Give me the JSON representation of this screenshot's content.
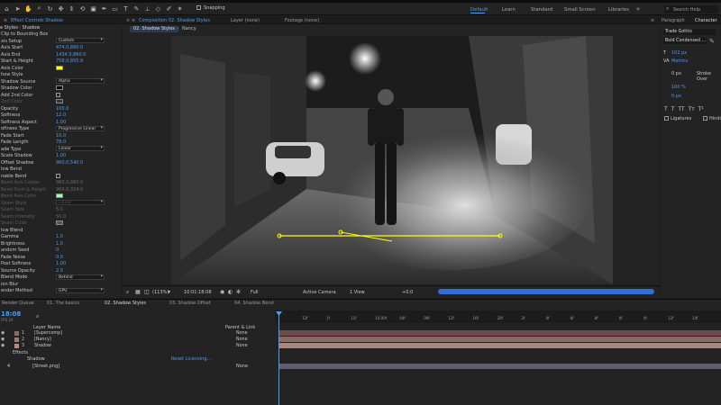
{
  "toolbar": {
    "snapping_label": "Snapping",
    "workspaces": [
      "Default",
      "Learn",
      "Standard",
      "Small Screen",
      "Libraries"
    ],
    "active_workspace": "Default",
    "search_placeholder": "Search Help"
  },
  "effects_panel": {
    "tab_label": "Effect Controls Shadow",
    "header": "e Styles · Shadow",
    "rows": [
      {
        "label": "Clip to Bounding Box",
        "kind": "text",
        "value": "",
        "dim": false
      },
      {
        "label": "xis Setup",
        "kind": "select",
        "value": "Custom"
      },
      {
        "label": "Axis Start",
        "kind": "value",
        "value": "474.0,860.0"
      },
      {
        "label": "Axis End",
        "kind": "value",
        "value": "1434.0,860.0"
      },
      {
        "label": "Start & Height",
        "kind": "value",
        "value": "758.0,855.9"
      },
      {
        "label": "Axis Color",
        "kind": "swatch",
        "value": "#ffff00"
      },
      {
        "label": "how Style",
        "kind": "text",
        "value": ""
      },
      {
        "label": "Shadow Source",
        "kind": "select",
        "value": "Alpha"
      },
      {
        "label": "Shadow Color",
        "kind": "swatch",
        "value": "#000000"
      },
      {
        "label": "Add 2nd Color",
        "kind": "check",
        "value": ""
      },
      {
        "label": "2nd Color",
        "kind": "swatch",
        "value": "#333333",
        "dim": true
      },
      {
        "label": "Opacity",
        "kind": "value",
        "value": "100.0"
      },
      {
        "label": "Softness",
        "kind": "value",
        "value": "12.0"
      },
      {
        "label": "Softness Aspect",
        "kind": "value",
        "value": "1.00"
      },
      {
        "label": "oftness Type",
        "kind": "select",
        "value": "Progressive Linear"
      },
      {
        "label": "Fade Start",
        "kind": "value",
        "value": "10.0"
      },
      {
        "label": "Fade Length",
        "kind": "value",
        "value": "78.0"
      },
      {
        "label": "ade Type",
        "kind": "select",
        "value": "Linear"
      },
      {
        "label": "Scale Shadow",
        "kind": "value",
        "value": "1.00"
      },
      {
        "label": "Offset Shadow",
        "kind": "value",
        "value": "960.0,540.0"
      },
      {
        "label": "low Bend",
        "kind": "text",
        "value": ""
      },
      {
        "label": "nable Bend",
        "kind": "check",
        "value": ""
      },
      {
        "label": "Bend Axis Center",
        "kind": "value",
        "value": "960.0,860.0",
        "dim": true
      },
      {
        "label": "Bend Start & Height",
        "kind": "value",
        "value": "960.0,324.0",
        "dim": true
      },
      {
        "label": "Bend Axis Color",
        "kind": "swatch",
        "value": "#9dffb0",
        "dim": true
      },
      {
        "label": "Seam Style",
        "kind": "select",
        "value": "Linear",
        "dim": true
      },
      {
        "label": "Seam Size",
        "kind": "value",
        "value": "5.0",
        "dim": true
      },
      {
        "label": "Seam Intensity",
        "kind": "value",
        "value": "50.0",
        "dim": true
      },
      {
        "label": "Seam Color",
        "kind": "swatch",
        "value": "#555555",
        "dim": true
      },
      {
        "label": "low Blend",
        "kind": "text",
        "value": ""
      },
      {
        "label": "Gamma",
        "kind": "value",
        "value": "1.0"
      },
      {
        "label": "Brightness",
        "kind": "value",
        "value": "1.0"
      },
      {
        "label": "andom Seed",
        "kind": "value",
        "value": "0"
      },
      {
        "label": "Fade Noise",
        "kind": "value",
        "value": "0.0"
      },
      {
        "label": "Post Softness",
        "kind": "value",
        "value": "1.00"
      },
      {
        "label": "Source Opacity",
        "kind": "value",
        "value": "2.0"
      },
      {
        "label": "Blend Mode",
        "kind": "select",
        "value": "Behind"
      },
      {
        "label": "ion Blur",
        "kind": "text",
        "value": ""
      },
      {
        "label": "ender Method",
        "kind": "select",
        "value": "GPU"
      }
    ]
  },
  "composition": {
    "tabs": [
      "Composition 02. Shadow Styles",
      "Layer (none)",
      "Footage (none)"
    ],
    "breadcrumbs": [
      "02. Shadow Styles",
      "Nancy"
    ],
    "footer": {
      "zoom": "(113%)",
      "timecode": "10:01:18:08",
      "resolution": "Full",
      "camera": "Active Camera",
      "view": "1 View",
      "offset": "+0.0"
    }
  },
  "right_panel": {
    "tabs": [
      "Paragraph",
      "Character"
    ],
    "font": "Trade Gothic",
    "style": "Bold Condensed ...",
    "size": "102 px",
    "tracking": "Metrics",
    "leading": "0 px",
    "scale_v": "100 %",
    "baseline": "0 px",
    "stroke": "Stroke Over",
    "ligatures": "Ligatures",
    "hindi": "Hindi"
  },
  "timeline": {
    "tabs": [
      "Render Queue",
      "01. The basics",
      "02. Shadow Styles",
      "03. Shadow Offset",
      "04. Shadow Bend"
    ],
    "time": "18:08",
    "fps": "FPS 24",
    "columns": {
      "name": "Layer Name",
      "parent": "Parent & Link"
    },
    "layers": [
      {
        "num": "1",
        "name": "[Supercomp]",
        "color": "#8a6b6b",
        "parent": "None"
      },
      {
        "num": "2",
        "name": "[Nancy]",
        "color": "#a27a73",
        "parent": "None"
      },
      {
        "num": "3",
        "name": "Shadow",
        "color": "#b88a85",
        "parent": "None"
      }
    ],
    "effects_group": "Effects",
    "effect_name": "Shadow",
    "reset": "Reset",
    "licensing": "Licensing...",
    "layer4": {
      "num": "4",
      "name": "[Street.png]",
      "parent": "None"
    },
    "ruler": [
      "12f",
      "1f",
      "11f",
      "10:00f",
      "04f",
      "08f",
      "12f",
      "16f",
      "20f",
      "2f",
      "4f",
      "6f",
      "8f",
      "0f",
      "4f",
      "12f",
      "14f"
    ]
  }
}
